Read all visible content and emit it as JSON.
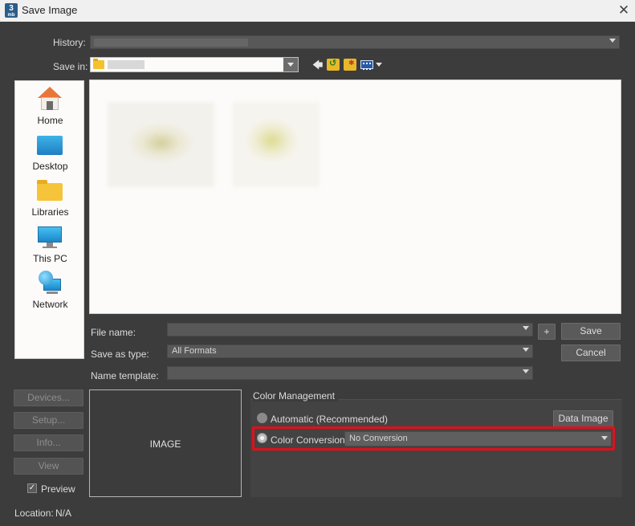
{
  "window": {
    "title": "Save Image",
    "app_icon_glyph": "3",
    "app_icon_sub": "mb",
    "close_glyph": "✕"
  },
  "history": {
    "label": "History:",
    "value": ""
  },
  "save_in": {
    "label": "Save in:",
    "value": ""
  },
  "toolbar": {
    "back_glyph": "🡄"
  },
  "places": [
    {
      "label": "Home",
      "icon": "home-icon"
    },
    {
      "label": "Desktop",
      "icon": "desktop-icon"
    },
    {
      "label": "Libraries",
      "icon": "libraries-icon"
    },
    {
      "label": "This PC",
      "icon": "this-pc-icon"
    },
    {
      "label": "Network",
      "icon": "network-icon"
    }
  ],
  "form": {
    "file_name_label": "File name:",
    "file_name_value": "",
    "save_as_type_label": "Save as type:",
    "save_as_type_value": "All Formats",
    "name_template_label": "Name template:",
    "name_template_value": ""
  },
  "buttons": {
    "plus": "+",
    "save": "Save",
    "cancel": "Cancel",
    "devices": "Devices...",
    "setup": "Setup...",
    "info": "Info...",
    "view": "View",
    "data_image": "Data Image"
  },
  "preview": {
    "checkbox_label": "Preview",
    "checkbox_glyph": "✓",
    "image_placeholder": "IMAGE"
  },
  "location": {
    "label": "Location:",
    "value": "N/A"
  },
  "color_management": {
    "title": "Color Management",
    "automatic_label": "Automatic (Recommended)",
    "conversion_label": "Color Conversion:",
    "conversion_value": "No Conversion"
  },
  "colors": {
    "dialog_bg": "#3c3c3c",
    "highlight": "#e0101b",
    "field_bg": "#585858"
  }
}
